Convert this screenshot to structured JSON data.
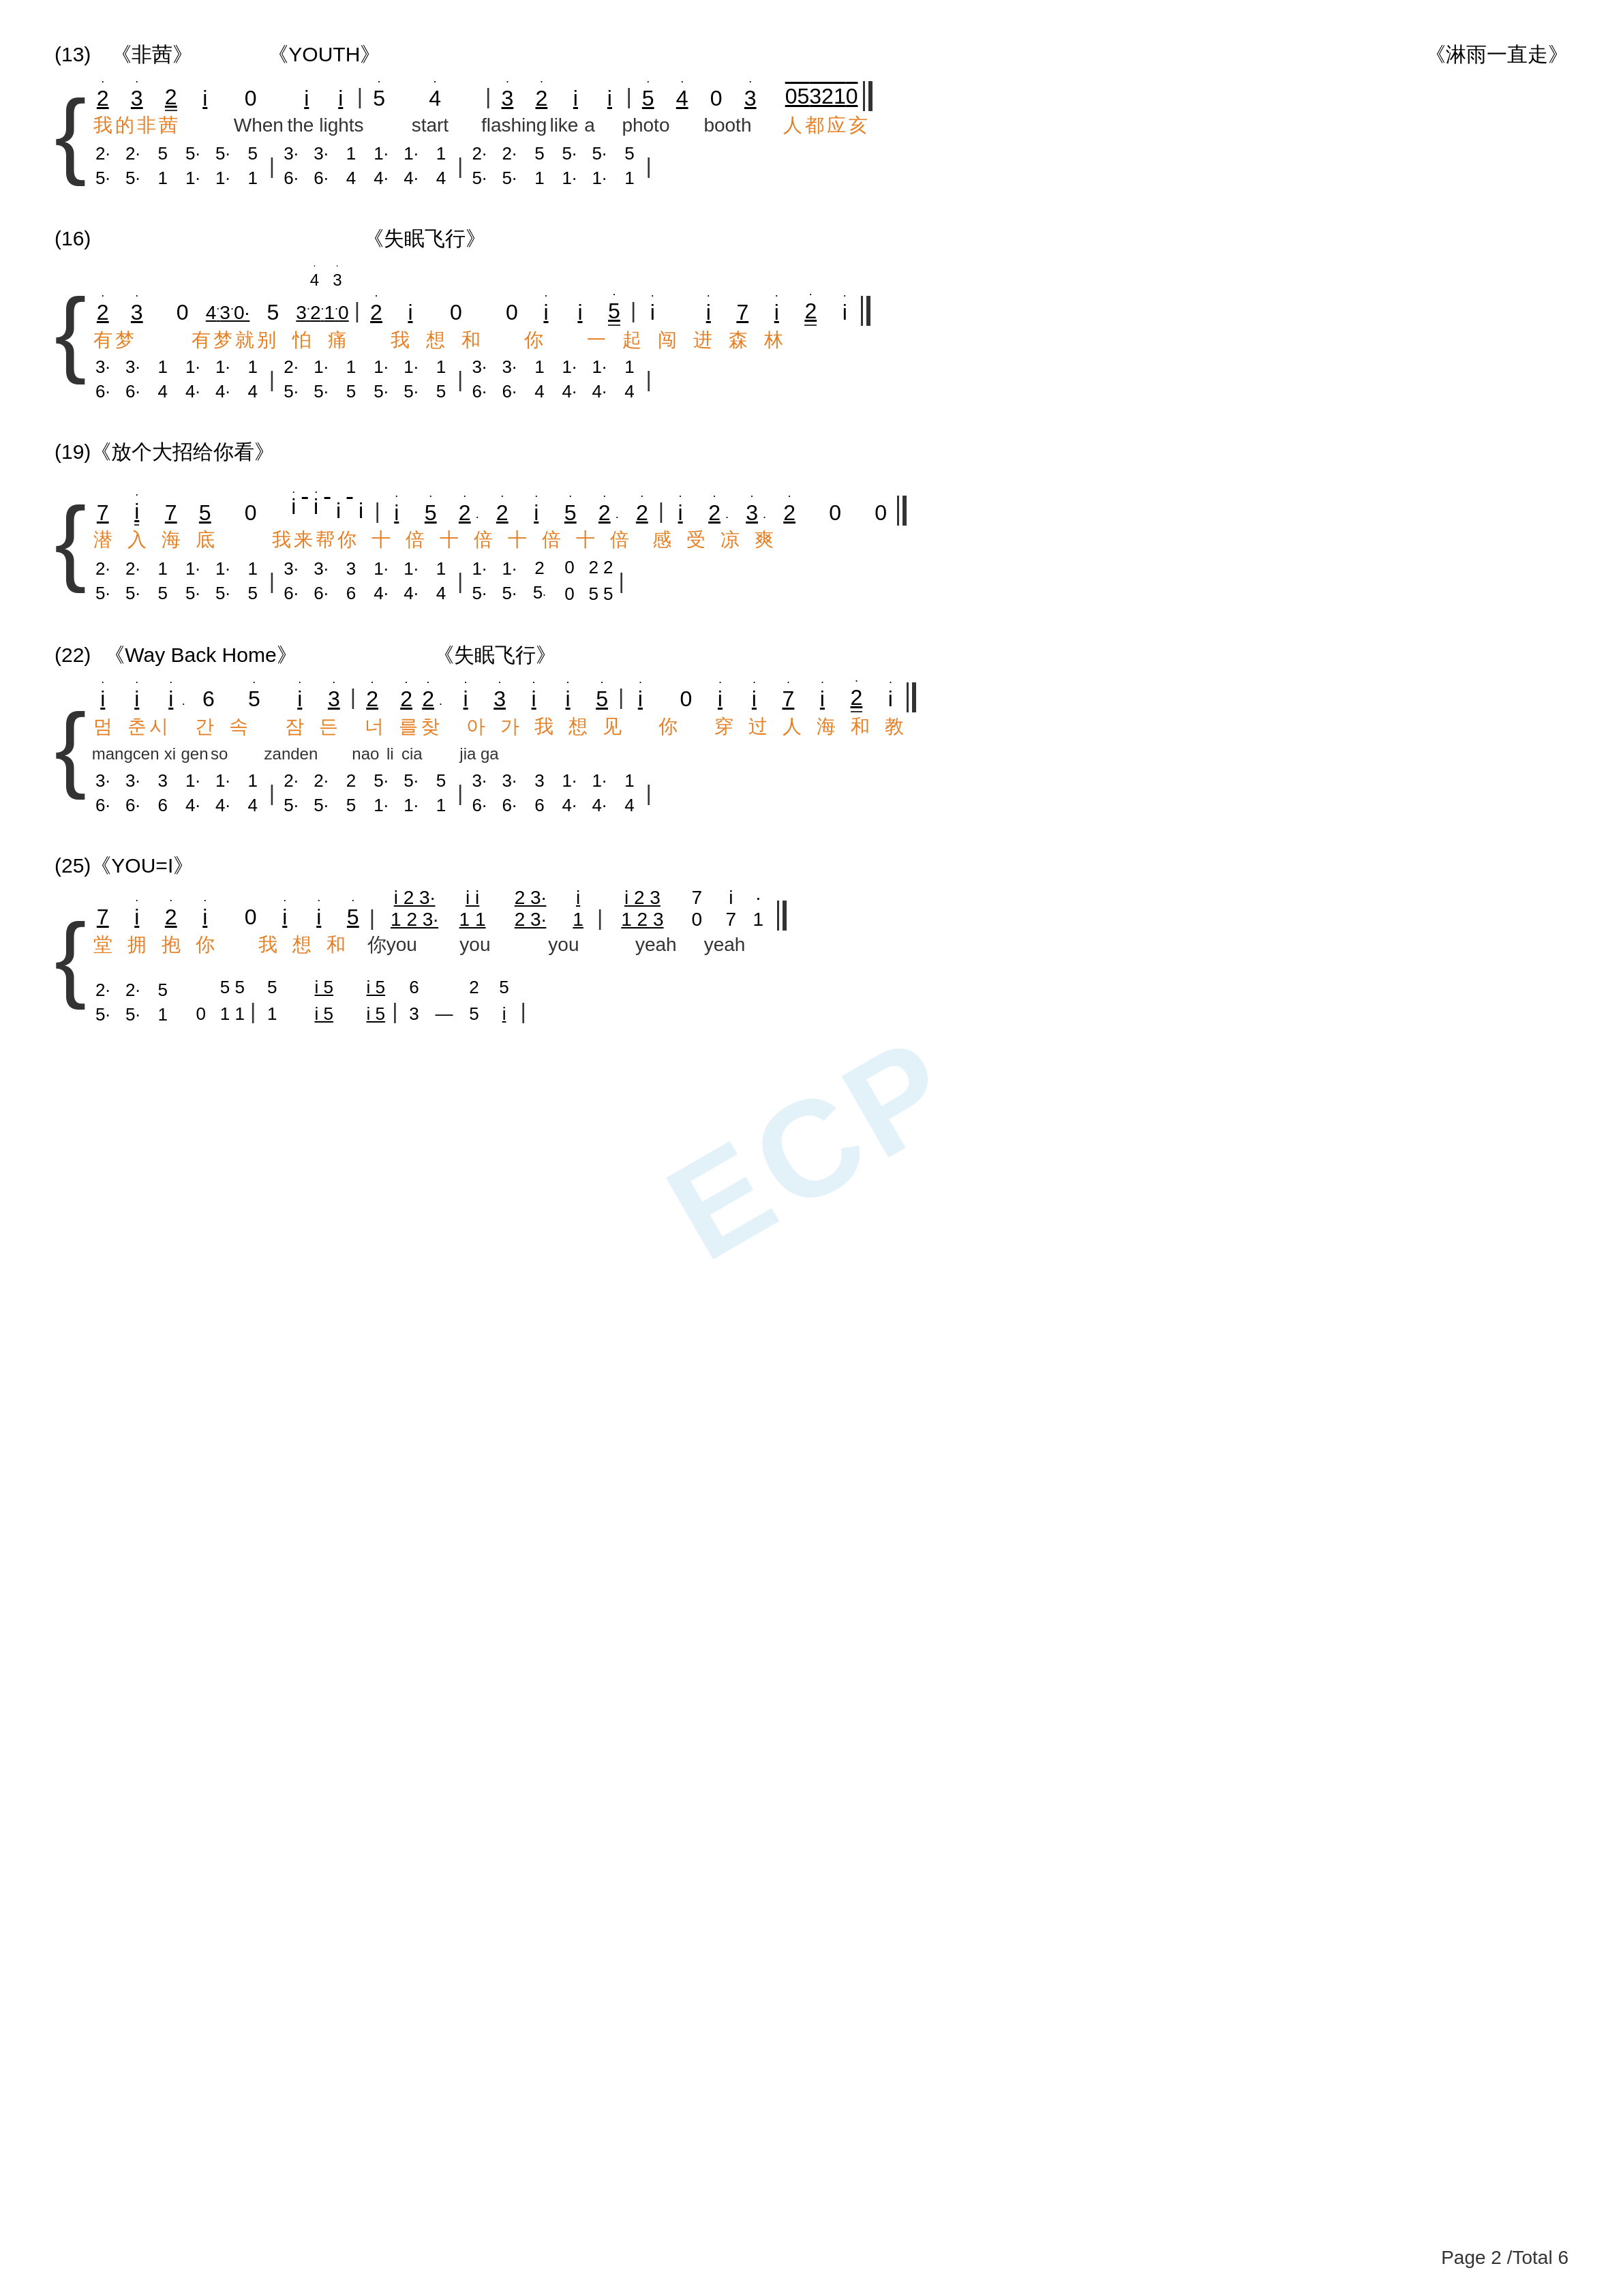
{
  "page": {
    "footer": "Page 2 /Total 6",
    "watermark": "ECP"
  },
  "sections": [
    {
      "id": "s13",
      "number": "(13)",
      "titles": [
        {
          "text": "《非茜》",
          "position": "left"
        },
        {
          "text": "《YOUTH》",
          "position": "center"
        },
        {
          "text": "《淋雨一直走》",
          "position": "right"
        }
      ]
    },
    {
      "id": "s16",
      "number": "(16)",
      "titles": [
        {
          "text": "",
          "position": "left"
        },
        {
          "text": "《失眠飞行》",
          "position": "center-right"
        }
      ]
    },
    {
      "id": "s19",
      "number": "(19)",
      "titles": [
        {
          "text": "《放个大招给你看》",
          "position": "center"
        }
      ]
    },
    {
      "id": "s22",
      "number": "(22)",
      "titles": [
        {
          "text": "《Way Back Home》",
          "position": "left"
        },
        {
          "text": "《失眠飞行》",
          "position": "center-right"
        }
      ]
    },
    {
      "id": "s25",
      "number": "(25)",
      "titles": [
        {
          "text": "《YOU=I》",
          "position": "center"
        }
      ]
    }
  ]
}
